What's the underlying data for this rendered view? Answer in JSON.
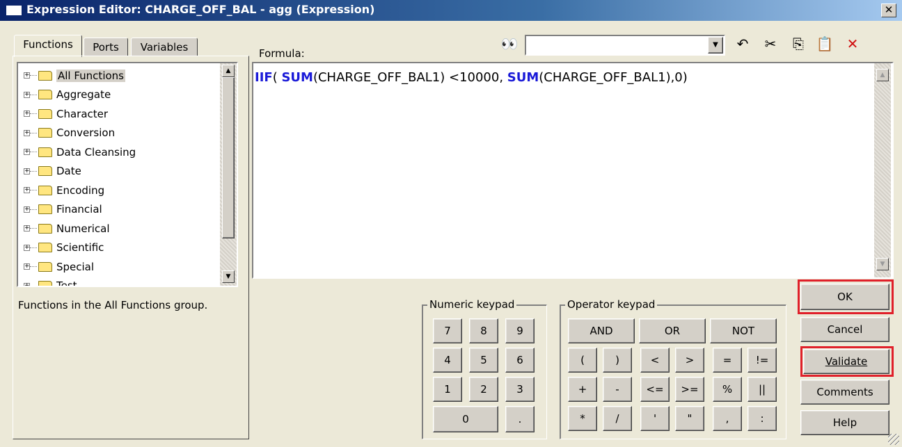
{
  "window": {
    "title": "Expression Editor: CHARGE_OFF_BAL - agg (Expression)",
    "close_glyph": "✕"
  },
  "tabs": [
    {
      "label": "Functions"
    },
    {
      "label": "Ports"
    },
    {
      "label": "Variables"
    }
  ],
  "tree": {
    "items": [
      {
        "label": "All Functions"
      },
      {
        "label": "Aggregate"
      },
      {
        "label": "Character"
      },
      {
        "label": "Conversion"
      },
      {
        "label": "Data Cleansing"
      },
      {
        "label": "Date"
      },
      {
        "label": "Encoding"
      },
      {
        "label": "Financial"
      },
      {
        "label": "Numerical"
      },
      {
        "label": "Scientific"
      },
      {
        "label": "Special"
      },
      {
        "label": "Test"
      }
    ],
    "selected": "All Functions"
  },
  "description": "Functions in the All Functions group.",
  "formula": {
    "label": "Formula:",
    "tokens": [
      {
        "text": "IIF",
        "kw": true
      },
      {
        "text": "( ",
        "kw": false
      },
      {
        "text": "SUM",
        "kw": true
      },
      {
        "text": "(CHARGE_OFF_BAL1) <10000, ",
        "kw": false
      },
      {
        "text": "SUM",
        "kw": true
      },
      {
        "text": "(CHARGE_OFF_BAL1),0)",
        "kw": false
      }
    ]
  },
  "search": {
    "value": ""
  },
  "toolbar": {
    "find_icon": "binoculars-icon",
    "undo_icon": "undo-icon",
    "cut_icon": "scissors-icon",
    "copy_icon": "copy-icon",
    "paste_icon": "paste-icon",
    "delete_icon": "delete-icon"
  },
  "numeric_keypad": {
    "title": "Numeric keypad",
    "keys": [
      "7",
      "8",
      "9",
      "4",
      "5",
      "6",
      "1",
      "2",
      "3",
      "0",
      "."
    ]
  },
  "operator_keypad": {
    "title": "Operator keypad",
    "row1": [
      "AND",
      "OR",
      "NOT"
    ],
    "row2": [
      "(",
      ")",
      "<",
      ">",
      "=",
      "!="
    ],
    "row3": [
      "+",
      "-",
      "<=",
      ">=",
      "%",
      "||"
    ],
    "row4": [
      "*",
      "/",
      "'",
      "\"",
      ",",
      ":"
    ]
  },
  "buttons": {
    "ok": "OK",
    "cancel": "Cancel",
    "validate": "Validate",
    "comments": "Comments",
    "help": "Help"
  },
  "highlight_color": "#e0202a",
  "keyword_color": "#1a1ad8"
}
